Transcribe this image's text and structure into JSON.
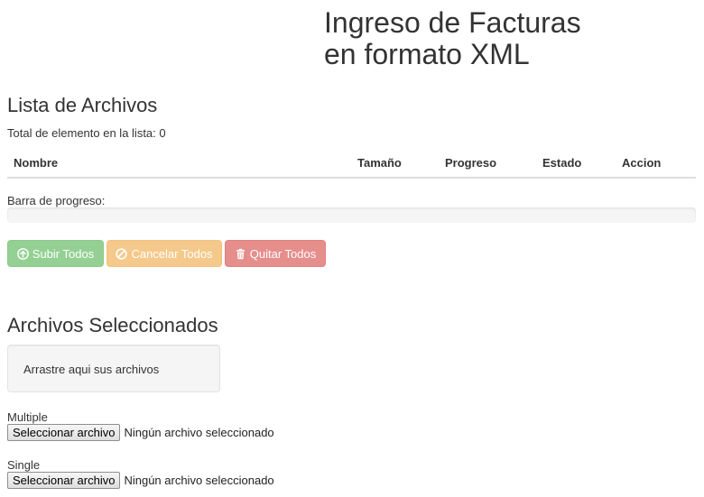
{
  "header": {
    "title_line1": "Ingreso de Facturas",
    "title_line2": "en formato XML"
  },
  "file_list": {
    "heading": "Lista de Archivos",
    "total_label": "Total de elemento en la lista: 0",
    "columns": [
      "Nombre",
      "Tamaño",
      "Progreso",
      "Estado",
      "Accion"
    ],
    "progress_label": "Barra de progreso:",
    "progress_value": 0
  },
  "actions": {
    "upload_all": "Subir Todos",
    "cancel_all": "Cancelar Todos",
    "remove_all": "Quitar Todos",
    "upload_icon": "circle-arrow-up-icon",
    "cancel_icon": "ban-circle-icon",
    "remove_icon": "trash-icon"
  },
  "selected_files": {
    "heading": "Archivos Seleccionados",
    "drop_zone_text": "Arrastre aqui sus archivos",
    "multiple_label": "Multiple",
    "single_label": "Single",
    "choose_button": "Seleccionar archivo",
    "no_file_text": "Ningún archivo seleccionado"
  },
  "colors": {
    "success": "#5cb85c",
    "warning": "#f0ad4e",
    "danger": "#d9534f",
    "text": "#333333"
  }
}
